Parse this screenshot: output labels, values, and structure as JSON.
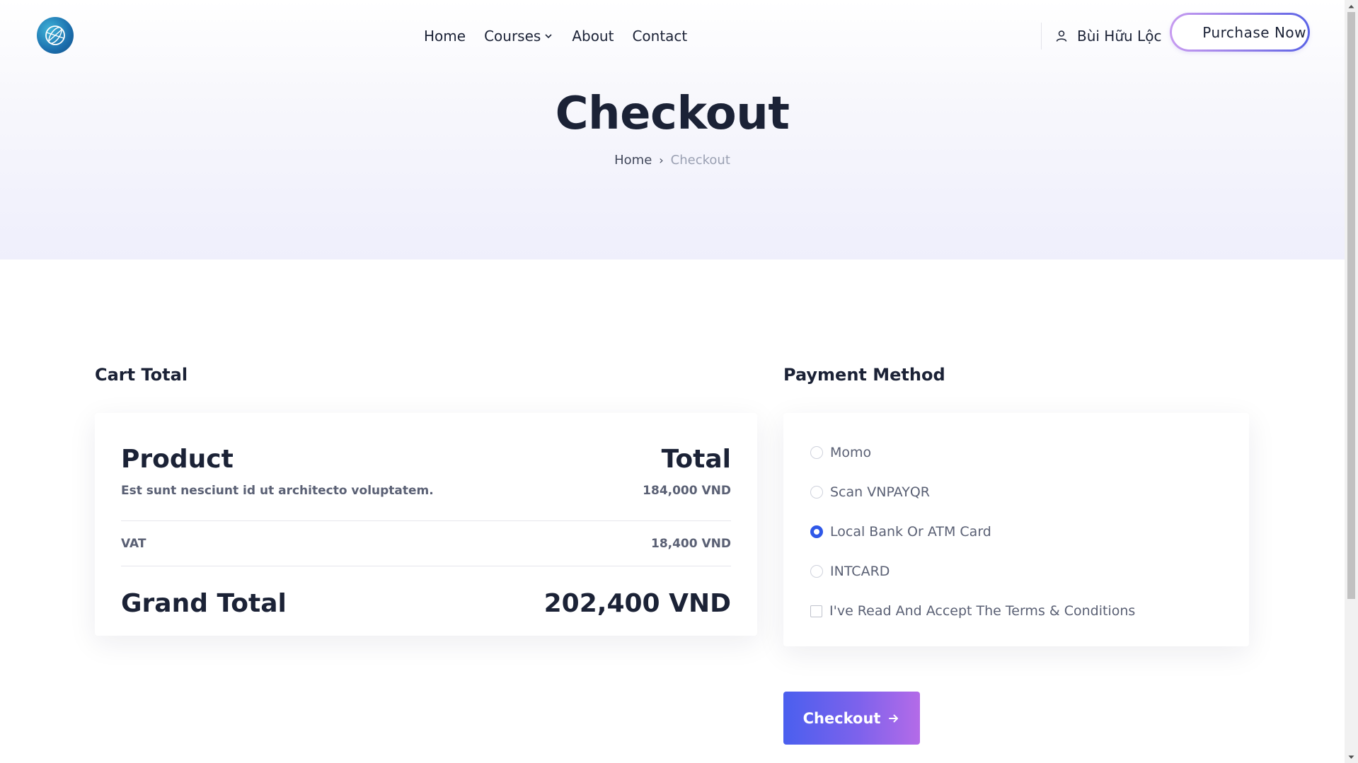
{
  "header": {
    "logo_name": "globe-logo",
    "nav": {
      "home": "Home",
      "courses": "Courses",
      "about": "About",
      "contact": "Contact"
    },
    "user_name": "Bùi Hữu Lộc",
    "purchase_label": "Purchase Now"
  },
  "hero": {
    "title": "Checkout",
    "breadcrumb": {
      "home": "Home",
      "separator": "›",
      "current": "Checkout"
    }
  },
  "cart": {
    "section_title": "Cart Total",
    "head_product": "Product",
    "head_total": "Total",
    "item": {
      "name": "Est sunt nesciunt id ut architecto voluptatem.",
      "price": "184,000 VND"
    },
    "vat": {
      "label": "VAT",
      "value": "18,400 VND"
    },
    "grand": {
      "label": "Grand Total",
      "value": "202,400 VND"
    }
  },
  "payment": {
    "section_title": "Payment Method",
    "options": [
      {
        "label": "Momo",
        "selected": false
      },
      {
        "label": "Scan VNPAYQR",
        "selected": false
      },
      {
        "label": "Local Bank Or ATM Card",
        "selected": true
      },
      {
        "label": "INTCARD",
        "selected": false
      }
    ],
    "terms_label": "I've Read And Accept The Terms & Conditions",
    "terms_checked": false
  },
  "checkout_button": "Checkout",
  "colors": {
    "accent_blue": "#2f58e8",
    "button_gradient_start": "#4a5fee",
    "button_gradient_end": "#b46be8",
    "text_dark": "#1b2236"
  }
}
